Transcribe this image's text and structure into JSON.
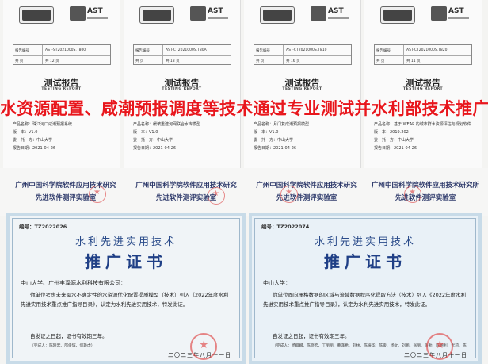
{
  "headline": "水资源配置、咸潮预报调度等技术通过专业测试并水利部技术推广",
  "reports": [
    {
      "logo_text": "AST",
      "code_row1": {
        "k": "报告编号",
        "v": "AST-ST2021000S.T800"
      },
      "code_row2": {
        "k": "共 页",
        "v": "共 12 页"
      },
      "title_cn": "测试报告",
      "title_en": "TESTING REPORT",
      "fields": [
        "产品名称：珠江河口咸潮预报系统",
        "版　本：V1.0",
        "委　托　方：中山大学",
        "报告日期：2021-04-26"
      ]
    },
    {
      "logo_text": "AST",
      "code_row1": {
        "k": "报告编号",
        "v": "AST-CT2021000S.T80A"
      },
      "code_row2": {
        "k": "共 页",
        "v": "共 18 页"
      },
      "title_cn": "测试报告",
      "title_en": "TESTING REPORT",
      "fields": [
        "产品名称：缓坡重建河网联合水库模型",
        "版　本：V1.0",
        "委　托　方：中山大学",
        "报告日期：2021-04-26"
      ]
    },
    {
      "logo_text": "AST",
      "code_row1": {
        "k": "报告编号",
        "v": "AST-CT2021000S.T810"
      },
      "code_row2": {
        "k": "共 页",
        "v": "共 16 页"
      },
      "title_cn": "测试报告",
      "title_en": "TESTING REPORT",
      "fields": [
        "产品名称：月门复成潮预报模型",
        "版　本：V1.0",
        "委　托　方：中山大学",
        "报告日期：2021-04-26"
      ]
    },
    {
      "logo_text": "AST",
      "code_row1": {
        "k": "报告编号",
        "v": "AST-CT2021000S.T820"
      },
      "code_row2": {
        "k": "共 页",
        "v": "共 11 页"
      },
      "title_cn": "测试报告",
      "title_en": "TESTING REPORT",
      "fields": [
        "产品名称：基于 WEAP 的城市群水资源评估与规划软件",
        "版　本：2019.202",
        "委　托　方：中山大学",
        "报告日期：2021-04-26"
      ]
    }
  ],
  "labs": [
    {
      "line1": "广州中国科学院软件应用技术研究",
      "line2": "先进软件测评实验室"
    },
    {
      "line1": "广州中国科学院软件应用技术研究",
      "line2": "先进软件测评实验室"
    },
    {
      "line1": "广州中国科学院软件应用技术研究",
      "line2": "先进软件测评实验室"
    },
    {
      "line1": "广州中国科学院软件应用技术研究所",
      "line2": "先进软件测评实验室"
    }
  ],
  "certs": [
    {
      "no": "编号：TZ2022026",
      "heading": "水利先进实用技术",
      "name": "推广证书",
      "unit": "中山大学、广州丰泽源水利科技有限公司：",
      "body": "你单位考虑未来需水不确定性的水资源优化配置提质模型（技术）列入《2022年度水利先进实用技术重点推广指导目录》，认定为水利先进实用技术，特发此证。",
      "validity": "自发证之日起，证书有效期三年。",
      "completers": "（完成人：陈晓宏、邵俊辉、何艳虎）",
      "date": "二〇二三年八月十一日"
    },
    {
      "no": "编号：TZ2022074",
      "heading": "水利先进实用技术",
      "name": "推广证书",
      "unit": "中山大学：",
      "body": "你单位面向栅格数据的区域与流域数据程序化提取方法（技术）列入《2022年度水利先进实用技术重点推广指导目录》，认定为水利先进实用技术，特发此证。",
      "validity": "自发证之日起，证书有效期三年。",
      "completers": "（完成人：杨麒麟、陈晓宏、丁丽丽、黄泽希、刘林、陈振华、陈俊、杨文、刘鹏、张丽、张勤、陈德利、尤莉、陈盖利）",
      "date": "二〇二三年八月十一日"
    }
  ]
}
